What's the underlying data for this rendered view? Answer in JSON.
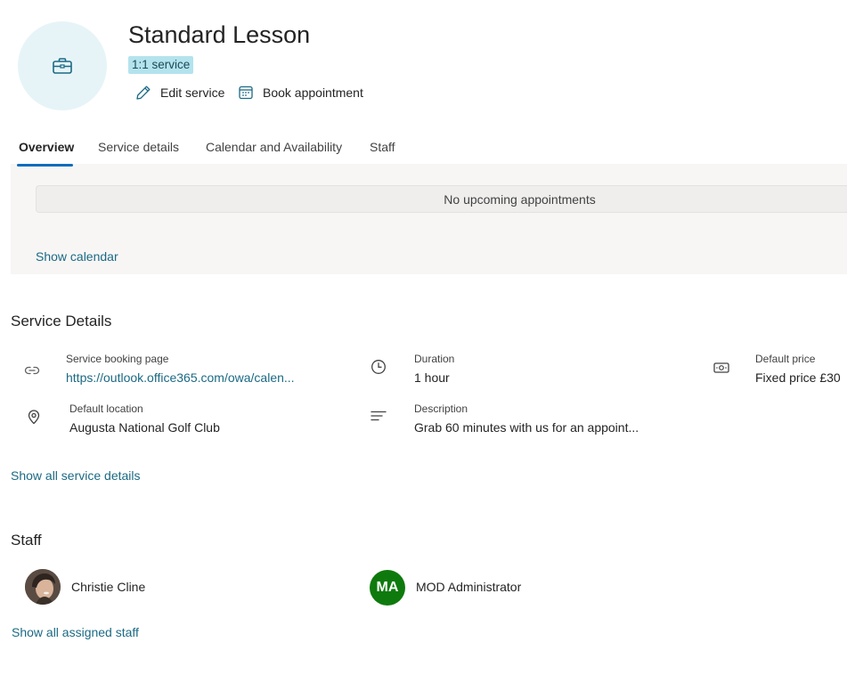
{
  "header": {
    "icon": "briefcase-icon",
    "title": "Standard Lesson",
    "badge": "1:1 service",
    "actions": {
      "edit_label": "Edit service",
      "edit_icon": "pencil-icon",
      "book_label": "Book appointment",
      "book_icon": "calendar-icon"
    }
  },
  "tabs": [
    {
      "label": "Overview",
      "active": true
    },
    {
      "label": "Service details",
      "active": false
    },
    {
      "label": "Calendar and Availability",
      "active": false
    },
    {
      "label": "Staff",
      "active": false
    }
  ],
  "overview": {
    "empty_message": "No upcoming appointments",
    "show_calendar": "Show calendar"
  },
  "service_details": {
    "title": "Service Details",
    "booking_page": {
      "label": "Service booking page",
      "value": "https://outlook.office365.com/owa/calen...",
      "icon": "link-icon"
    },
    "duration": {
      "label": "Duration",
      "value": "1 hour",
      "icon": "clock-icon"
    },
    "price": {
      "label": "Default price",
      "value": "Fixed price £30",
      "icon": "money-icon"
    },
    "location": {
      "label": "Default location",
      "value": "Augusta National Golf Club",
      "icon": "location-icon"
    },
    "description": {
      "label": "Description",
      "value": "Grab 60 minutes with us for an appoint...",
      "icon": "text-align-icon"
    },
    "show_all": "Show all service details"
  },
  "staff": {
    "title": "Staff",
    "members": [
      {
        "name": "Christie Cline",
        "avatar": "photo"
      },
      {
        "name": "MOD Administrator",
        "initials": "MA"
      }
    ],
    "show_all": "Show all assigned staff"
  },
  "colors": {
    "accent": "#0f6cbd",
    "link": "#1b6a84",
    "badge_bg": "#b4e3ee",
    "icon_circle": "#e6f4f8",
    "avatar_green": "#0e7a0d"
  }
}
